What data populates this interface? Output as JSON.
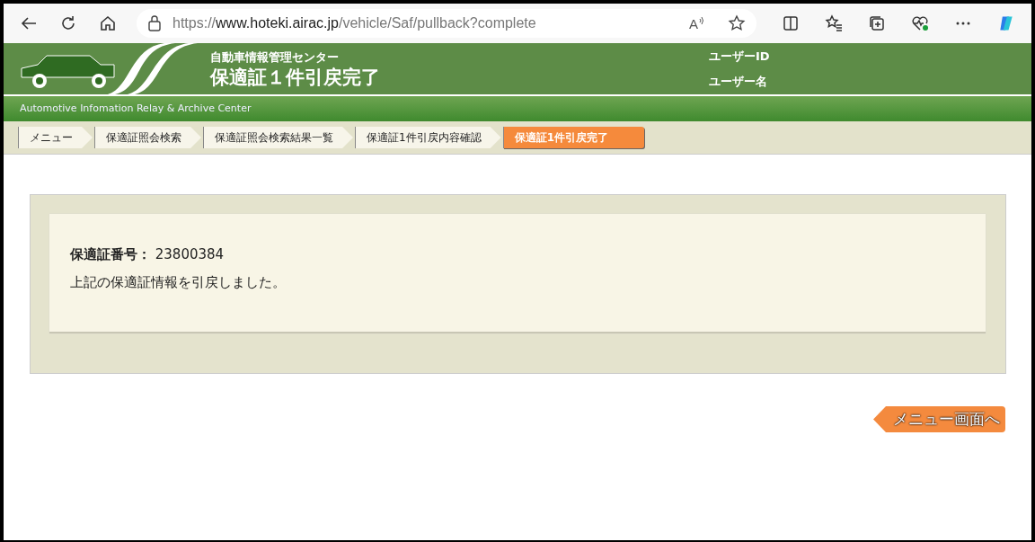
{
  "browser": {
    "url_scheme": "https://",
    "url_host": "www.hoteki.airac.jp",
    "url_path": "/vehicle/Saf/pullback?complete",
    "read_aloud_glyph": "A"
  },
  "header": {
    "organization": "自動車情報管理センター",
    "page_title": "保適証１件引戻完了",
    "user_id_label": "ユーザーID",
    "user_name_label": "ユーザー名",
    "subtitle": "Automotive Infomation Relay & Archive Center"
  },
  "breadcrumbs": [
    {
      "label": "メニュー",
      "selected": false
    },
    {
      "label": "保適証照会検索",
      "selected": false
    },
    {
      "label": "保適証照会検索結果一覧",
      "selected": false
    },
    {
      "label": "保適証1件引戻内容確認",
      "selected": false
    },
    {
      "label": "保適証1件引戻完了",
      "selected": true
    }
  ],
  "result": {
    "number_label": "保適証番号：",
    "number_value": "23800384",
    "message": "上記の保適証情報を引戻しました。"
  },
  "menu_button": "メニュー画面へ"
}
